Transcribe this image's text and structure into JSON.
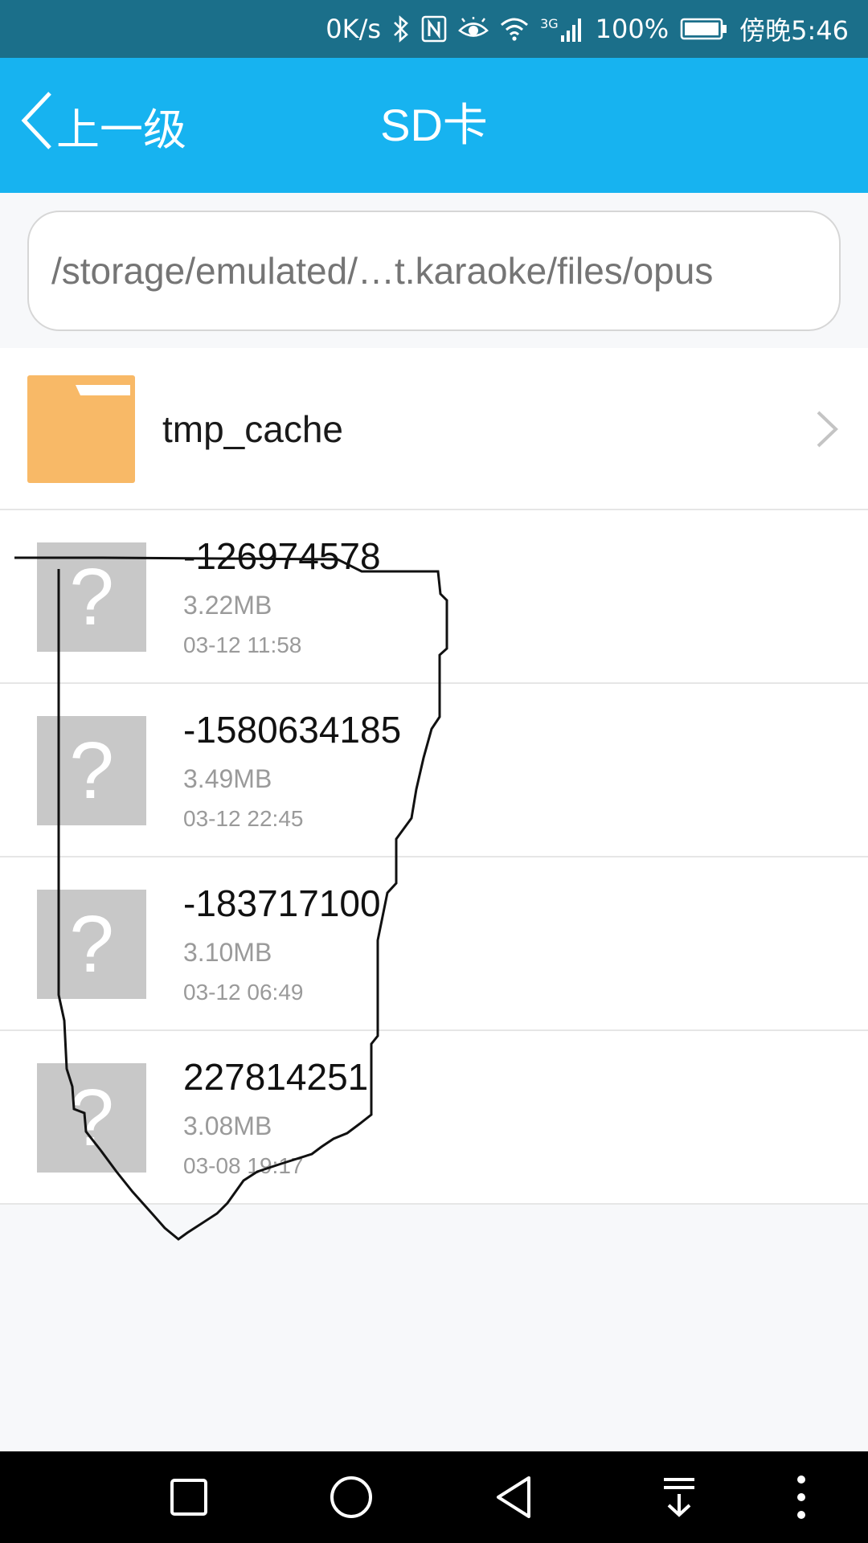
{
  "status_bar": {
    "network_speed": "0K/s",
    "network_type": "3G",
    "battery_percent": "100%",
    "time": "傍晚5:46",
    "icons": [
      "bluetooth-icon",
      "nfc-icon",
      "eye-icon",
      "wifi-icon",
      "signal-icon",
      "battery-icon"
    ]
  },
  "header": {
    "back_label": "上一级",
    "title": "SD卡"
  },
  "path_bar": {
    "path": "/storage/emulated/…t.karaoke/files/opus"
  },
  "folders": [
    {
      "name": "tmp_cache",
      "icon": "folder-icon"
    }
  ],
  "files": [
    {
      "name": "-126974578",
      "size": "3.22MB",
      "date": "03-12 11:58",
      "icon": "unknown-file-icon"
    },
    {
      "name": "-1580634185",
      "size": "3.49MB",
      "date": "03-12 22:45",
      "icon": "unknown-file-icon"
    },
    {
      "name": "-183717100",
      "size": "3.10MB",
      "date": "03-12 06:49",
      "icon": "unknown-file-icon"
    },
    {
      "name": "227814251",
      "size": "3.08MB",
      "date": "03-08 19:17",
      "icon": "unknown-file-icon"
    }
  ],
  "file_icon_glyph": "?",
  "nav_bar": {
    "buttons": [
      "recents-square-icon",
      "home-circle-icon",
      "back-triangle-icon",
      "notification-pulldown-icon",
      "more-dots-icon"
    ]
  },
  "colors": {
    "status_bar": "#1b6f8a",
    "header": "#17b3f0",
    "folder": "#f8b967",
    "file_placeholder": "#c8c8c8"
  }
}
